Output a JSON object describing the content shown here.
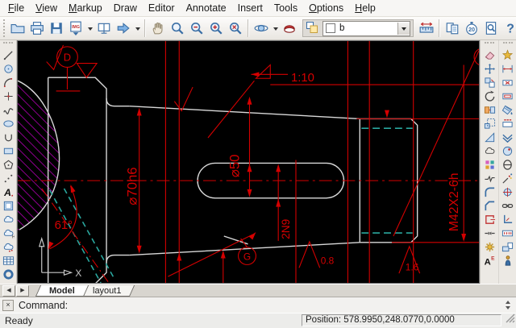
{
  "menu": {
    "items": [
      {
        "label": "File",
        "u": 0
      },
      {
        "label": "View",
        "u": 0
      },
      {
        "label": "Markup",
        "u": 0
      },
      {
        "label": "Draw",
        "u": -1
      },
      {
        "label": "Editor",
        "u": -1
      },
      {
        "label": "Annotate",
        "u": -1
      },
      {
        "label": "Insert",
        "u": -1
      },
      {
        "label": "Tools",
        "u": -1
      },
      {
        "label": "Options",
        "u": 0
      },
      {
        "label": "Help",
        "u": 0
      }
    ]
  },
  "toolbar": {
    "left_items": [
      "open",
      "print",
      "save",
      "imgexport",
      "dd",
      "screens",
      "goarrow",
      "dd",
      "sep",
      "pan",
      "zoomwin",
      "zoomout",
      "zoomin",
      "zoomext",
      "sep",
      "orbit",
      "dd",
      "render"
    ],
    "right_items": [
      "measure",
      "sep",
      "pages",
      "stopwatch",
      "preview",
      "help"
    ],
    "layer_combo": {
      "value": "b"
    }
  },
  "palettes": {
    "draw_tools": [
      "line",
      "circle",
      "arc",
      "point",
      "spline",
      "ellipse",
      "arc3p",
      "rectangle",
      "polygon",
      "points",
      "text",
      "image",
      "group",
      "grouph",
      "groupd",
      "table",
      "donut"
    ],
    "modify_tools": [
      "eraser",
      "move",
      "copy",
      "rotate",
      "stretch",
      "scale",
      "triangle",
      "cloud",
      "pattern",
      "breakline",
      "fillet",
      "chamfer",
      "rectopen",
      "join",
      "gear",
      "textedit"
    ],
    "dimension_tools": [
      "explode",
      "dimjog",
      "dimx",
      "dimframe",
      "hatch",
      "dimh",
      "wings",
      "circledot",
      "theta",
      "sprinkle",
      "target",
      "chain",
      "cornerl",
      "dimhh",
      "workstation",
      "person"
    ]
  },
  "tabs": {
    "prev": "◀",
    "next": "▶",
    "items": [
      {
        "label": "Model",
        "active": true
      },
      {
        "label": "layout1",
        "active": false
      }
    ]
  },
  "command": {
    "close": "×",
    "label": "Command:"
  },
  "status": {
    "ready": "Ready",
    "position": "Position: 578.9950,248.0770,0.0000"
  },
  "drawing": {
    "labels": {
      "taper": "1:10",
      "dia50": "⌀50",
      "dia70": "⌀70h6",
      "key": "2N9",
      "thread": "M42X2-6h",
      "angle": "61°",
      "rough_a": "0.8",
      "rough_b": "1.6",
      "datum_d": "D",
      "datum_g": "G",
      "axis_x": "X"
    },
    "colors": {
      "dimension": "#d40000",
      "outline": "#d9d9d9",
      "hidden": "#2aa79e",
      "hatch": "#b400b4",
      "background": "#000000"
    }
  }
}
